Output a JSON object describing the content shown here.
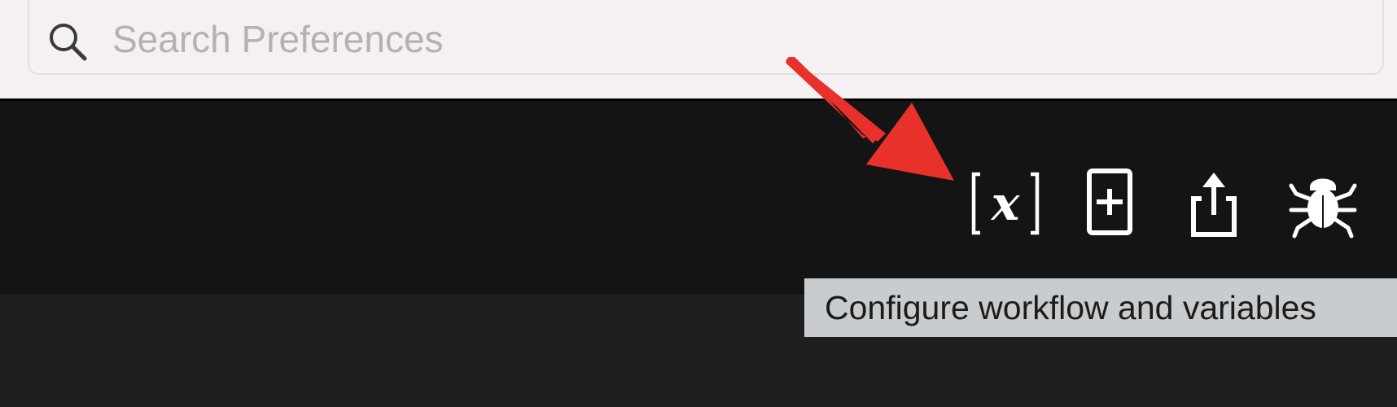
{
  "search": {
    "placeholder": "Search Preferences",
    "value": ""
  },
  "toolbar": {
    "buttons": [
      {
        "name": "variables",
        "icon": "variables-icon",
        "glyph": "[x]"
      },
      {
        "name": "add",
        "icon": "plus-square-icon"
      },
      {
        "name": "share",
        "icon": "share-icon"
      },
      {
        "name": "debug",
        "icon": "bug-icon"
      }
    ]
  },
  "tooltip": {
    "text": "Configure workflow and variables"
  },
  "colors": {
    "top_bar": "#f5f1f3",
    "toolbar": "#141414",
    "content": "#1f1f1f",
    "tooltip_bg": "#c9cccf",
    "arrow": "#e8312a",
    "icon": "#ffffff"
  }
}
